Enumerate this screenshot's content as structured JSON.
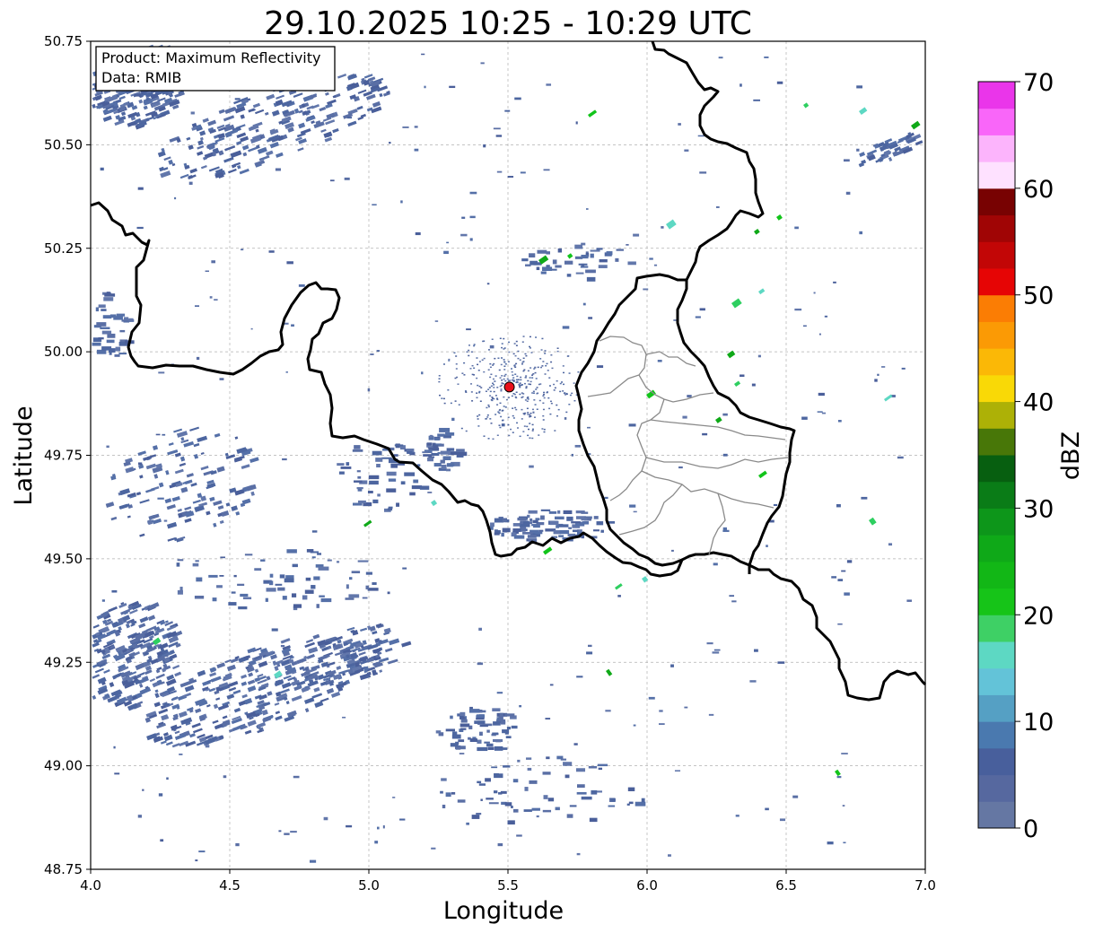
{
  "title": "29.10.2025 10:25 - 10:29 UTC",
  "map": {
    "xlabel": "Longitude",
    "ylabel": "Latitude",
    "xlim": [
      4.0,
      7.0
    ],
    "ylim": [
      48.75,
      50.75
    ],
    "x_ticks": [
      "4.0",
      "4.5",
      "5.0",
      "5.5",
      "6.0",
      "6.5",
      "7.0"
    ],
    "y_ticks": [
      "48.75",
      "49.00",
      "49.25",
      "49.50",
      "49.75",
      "50.00",
      "50.25",
      "50.50",
      "50.75"
    ],
    "grid": true,
    "radar_site": {
      "lon": 5.505,
      "lat": 49.915,
      "color": "#e8101a"
    }
  },
  "legend_box": {
    "line1": "Product: Maximum Reflectivity",
    "line2": "Data: RMIB"
  },
  "colorbar": {
    "label": "dBZ",
    "min": 0,
    "max": 70,
    "ticks": [
      "0",
      "10",
      "20",
      "30",
      "40",
      "50",
      "60",
      "70"
    ],
    "colors": [
      "#6577a3",
      "#56689f",
      "#485f9c",
      "#4a79af",
      "#55a0c4",
      "#63c3d8",
      "#5dd8c3",
      "#3ed065",
      "#16c418",
      "#12b716",
      "#0fa918",
      "#0d961a",
      "#0a7c17",
      "#075f10",
      "#487708",
      "#adb106",
      "#f9d906",
      "#fbb806",
      "#fb9a05",
      "#fb7d04",
      "#e60505",
      "#c20606",
      "#a00505",
      "#780202",
      "#fee1ff",
      "#fcb4fc",
      "#f966f9",
      "#ea35ea"
    ]
  }
}
